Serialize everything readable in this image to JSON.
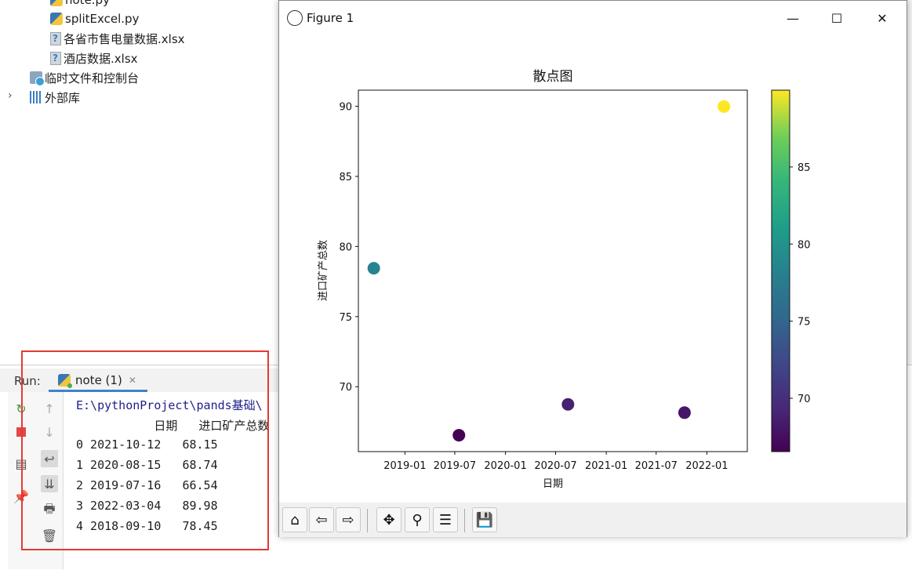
{
  "project_tree": {
    "items": [
      {
        "label": "note.py",
        "icon": "python-file-icon"
      },
      {
        "label": "splitExcel.py",
        "icon": "python-file-icon"
      },
      {
        "label": "各省市售电量数据.xlsx",
        "icon": "unknown-file-icon"
      },
      {
        "label": "酒店数据.xlsx",
        "icon": "unknown-file-icon"
      },
      {
        "label": "临时文件和控制台",
        "icon": "scratches-icon"
      },
      {
        "label": "外部库",
        "icon": "external-libraries-icon"
      }
    ]
  },
  "run": {
    "label": "Run:",
    "tab_label": "note (1)",
    "console_path": "E:\\pythonProject\\pands基础\\",
    "console_header": "           日期   进口矿产总数",
    "console_rows": [
      "0 2021-10-12   68.15",
      "1 2020-08-15   68.74",
      "2 2019-07-16   66.54",
      "3 2022-03-04   89.98",
      "4 2018-09-10   78.45"
    ]
  },
  "figure": {
    "window_title": "Figure 1",
    "minimize": "—",
    "maximize": "☐",
    "close": "✕",
    "toolbar": [
      "home",
      "back",
      "forward",
      "pan",
      "zoom",
      "configure-subplots",
      "save"
    ]
  },
  "chart_data": {
    "type": "scatter",
    "title": "散点图",
    "xlabel": "日期",
    "ylabel": "进口矿产总数",
    "x": [
      "2021-10-12",
      "2020-08-15",
      "2019-07-16",
      "2022-03-04",
      "2018-09-10"
    ],
    "y": [
      68.15,
      68.74,
      66.54,
      89.98,
      78.45
    ],
    "x_ticks": [
      "2019-01",
      "2019-07",
      "2020-01",
      "2020-07",
      "2021-01",
      "2021-07",
      "2022-01"
    ],
    "y_ticks": [
      70,
      75,
      80,
      85,
      90
    ],
    "colorbar": {
      "colormap": "viridis",
      "ticks": [
        70,
        75,
        80,
        85
      ],
      "range": [
        66.54,
        89.98
      ]
    },
    "grid": false
  },
  "colors": {
    "accent": "#4083c9",
    "highlight_box": "#e53935"
  }
}
